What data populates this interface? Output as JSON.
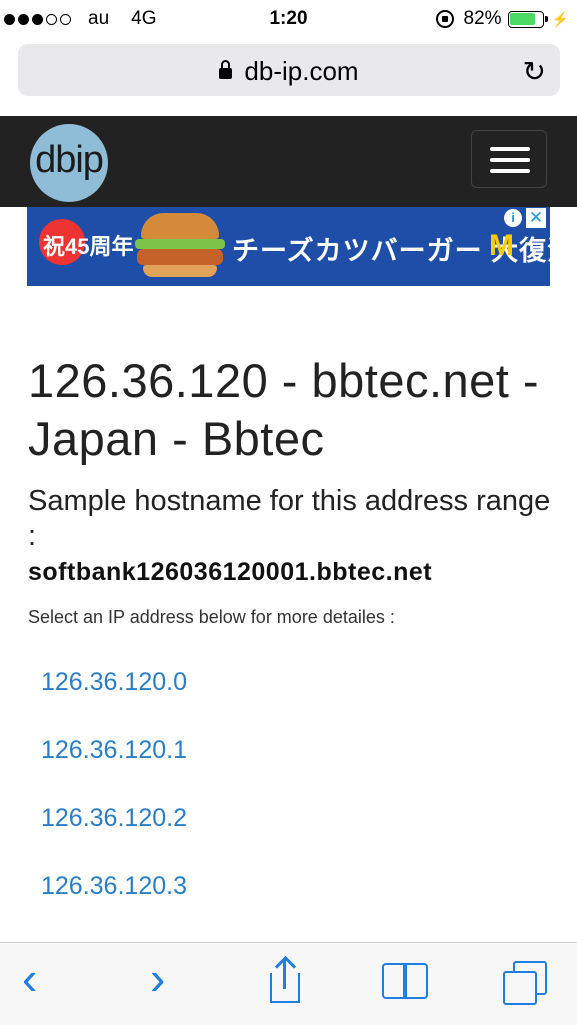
{
  "status_bar": {
    "signal_dots_filled": 3,
    "signal_dots_total": 5,
    "carrier": "au",
    "network": "4G",
    "time": "1:20",
    "battery_text": "82%",
    "battery_level": 0.82
  },
  "browser": {
    "url": "db-ip.com",
    "icons": [
      "padlock-icon",
      "reload-icon"
    ]
  },
  "site": {
    "logo_text": "dbip",
    "menu_icon": "hamburger-menu-icon"
  },
  "ad": {
    "badge_text": "祝45周年",
    "headline": "チーズカツバーガー 大復活",
    "brand_mark": "M",
    "info_icon": "i",
    "close_icon": "✕"
  },
  "content": {
    "title": "126.36.120 - bbtec.net - Japan - Bbtec",
    "sample_label": "Sample hostname for this address range :",
    "hostname": "softbank126036120001.bbtec.net",
    "hint": "Select an IP address below for more detailes :",
    "ip_links": [
      "126.36.120.0",
      "126.36.120.1",
      "126.36.120.2",
      "126.36.120.3"
    ]
  },
  "toolbar": {
    "back_icon": "‹",
    "forward_icon": "›",
    "icons": [
      "back-icon",
      "forward-icon",
      "share-icon",
      "bookmarks-icon",
      "tabs-icon"
    ]
  },
  "colors": {
    "header_bg": "#222222",
    "logo_bg": "#8fbcd6",
    "link": "#2a7ec7",
    "toolbar_accent": "#1f7ee0",
    "battery": "#4cd964"
  }
}
